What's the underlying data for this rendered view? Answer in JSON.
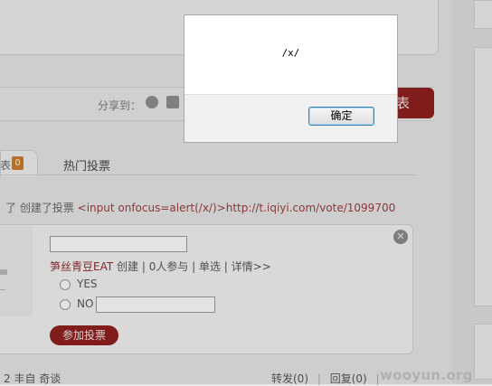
{
  "share": {
    "label": "分享到：",
    "publish_label": "表"
  },
  "tabs": {
    "active_label": "表",
    "active_count": "0",
    "hot_label": "热门投票"
  },
  "vote_activity": {
    "prefix": "了 创建了投票 ",
    "payload": "<input onfocus=alert(/x/)>http://t.iqiyi.com/vote/1099700"
  },
  "vote_card": {
    "creator": "笋丝青豆EAT",
    "meta": " 创建 | 0人参与 | 单选 | 详情>>",
    "options": [
      {
        "label": "YES"
      },
      {
        "label": "NO"
      }
    ],
    "join_label": "参加投票",
    "close_glyph": "✕"
  },
  "footer": {
    "left_text": "2 丰自 奇谈",
    "forward": "转发(0)",
    "reply": "回复(0)",
    "sep": "|"
  },
  "watermark": "wooyun.org",
  "dialog": {
    "message": "/x/",
    "ok_label": "确定"
  },
  "colors": {
    "brand_red": "#8e1b1b",
    "count_orange": "#d07a28",
    "link_red": "#9b3b3b"
  }
}
